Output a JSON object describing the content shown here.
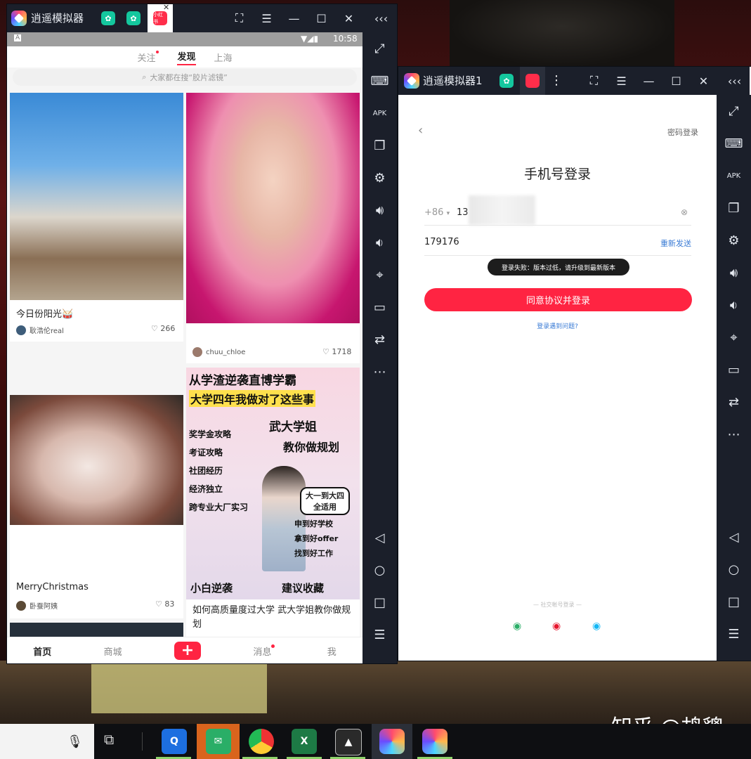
{
  "window1": {
    "title": "逍遥模拟器",
    "tabs": [
      "app",
      "app",
      "小红书"
    ],
    "status_time": "10:58",
    "status_left": "A",
    "nav": {
      "follow": "关注",
      "discover": "发现",
      "city": "上海"
    },
    "search_placeholder": "大家都在搜“胶片滤镜”",
    "cards": [
      {
        "title": "今日份阳光🥁",
        "author": "耿浩伦real",
        "likes": "266"
      },
      {
        "title": "",
        "author": "chuu_chloe",
        "likes": "1718"
      },
      {
        "title": "MerryChristmas",
        "author": "卧蚕阿姨",
        "likes": "83"
      },
      {
        "title": "如何高质量度过大学  武大学姐教你做规划",
        "author": "",
        "likes": ""
      }
    ],
    "poster": {
      "headline1": "从学渣逆袭直博学霸",
      "headline2": "大学四年我做对了这些事",
      "sub1": "武大学姐",
      "sub2": "教你做规划",
      "items": [
        "奖学金攻略",
        "考证攻略",
        "社团经历",
        "经济独立",
        "跨专业大厂实习"
      ],
      "bubble1": "大一到大四",
      "bubble2": "全适用",
      "right1": "申到好学校",
      "right2": "拿到好offer",
      "right3": "找到好工作",
      "footer1": "小白逆袭",
      "footer2": "建议收藏"
    },
    "tabbar": {
      "home": "首页",
      "mall": "商城",
      "messages": "消息",
      "me": "我"
    }
  },
  "window2": {
    "title": "逍遥模拟器1",
    "password_login": "密码登录",
    "heading": "手机号登录",
    "country_code": "+86",
    "phone_prefix": "13",
    "code_value": "179176",
    "resend": "重新发送",
    "toast": "登录失败：版本过低，请升级到最新版本",
    "login_button": "同意协议并登录",
    "trouble": "登录遇到问题?",
    "social_title": "社交帐号登录"
  },
  "watermark": "知乎 @鸪貔",
  "colors": {
    "accent": "#ff2442",
    "titlebar": "#1b1f2a",
    "link": "#3a7bd5"
  }
}
